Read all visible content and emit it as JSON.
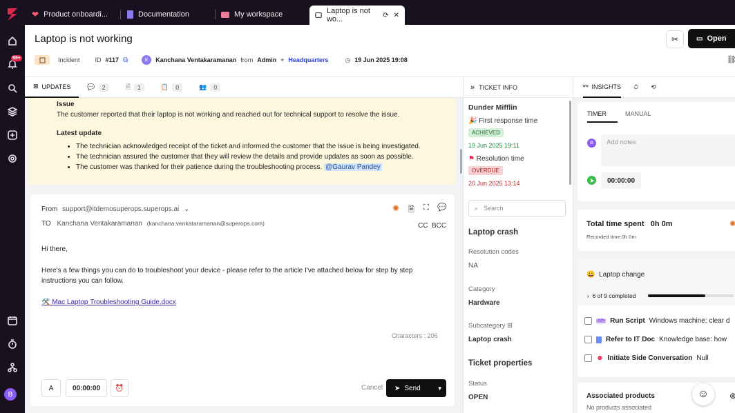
{
  "tabs": [
    {
      "label": "Product onboardi..."
    },
    {
      "label": "Documentation"
    },
    {
      "label": "My workspace"
    },
    {
      "label": "Laptop is not wo..."
    }
  ],
  "rail": {
    "notif_badge": "99+",
    "avatar": "B"
  },
  "ticket": {
    "title": "Laptop is not working",
    "type": "Incident",
    "id_label": "ID",
    "id": "#117",
    "avatar": "K",
    "requester": "Kanchana Ventakaramanan",
    "from_label": "from",
    "org": "Admin",
    "site": "Headquarters",
    "date": "19 Jun 2025 19:08",
    "status_button": "Open"
  },
  "left_tabs": [
    {
      "label": "UPDATES"
    },
    {
      "count": "2"
    },
    {
      "count": "1"
    },
    {
      "count": "0"
    },
    {
      "count": "0"
    }
  ],
  "note": {
    "issue_heading": "Issue",
    "issue_text": "The customer reported that their laptop is not working and reached out for technical support to resolve the issue.",
    "update_heading": "Latest update",
    "bullets": [
      "The technician acknowledged receipt of the ticket and informed the customer that the issue is being investigated.",
      "The technician assured the customer that they will review the details and provide updates as soon as possible.",
      "The customer was thanked for their patience during the troubleshooting process."
    ],
    "mention": "@Gaurav Pandey"
  },
  "composer": {
    "from_label": "From",
    "from": "support@itdemosuperops.superops.ai",
    "to_label": "TO",
    "to_name": "Kanchana Ventakaramanan",
    "to_email": "(kanchana.venkataramanan@superops.com)",
    "cc": "CC",
    "bcc": "BCC",
    "greeting": "Hi there,",
    "body": "Here's a few things you can do to troubleshoot your device - please refer to the article I've attached below for step by step instructions you can follow.",
    "attachment": "🛠️ Mac Laptop Troubleshooting Guide.docx",
    "chars": "Characters : 206",
    "format_btn": "A",
    "timer": "00:00:00",
    "cancel": "Cancel",
    "send": "Send"
  },
  "ticket_info": {
    "header": "TICKET INFO",
    "client": "Dunder Mifflin",
    "first_response_label": "First response time",
    "first_response_status": "ACHIEVED",
    "first_response_date": "19 Jun 2025 19:11",
    "resolution_label": "Resolution time",
    "resolution_status": "OVERDUE",
    "resolution_date": "20 Jun 2025 13:14",
    "search_placeholder": "Search",
    "section": "Laptop crash",
    "res_codes_label": "Resolution codes",
    "res_codes_value": "NA",
    "category_label": "Category",
    "category_value": "Hardware",
    "subcategory_label": "Subcategory",
    "subcategory_value": "Laptop crash",
    "props_heading": "Ticket properties",
    "status_label": "Status",
    "status_value": "OPEN"
  },
  "insights": {
    "header": "INSIGHTS",
    "timer_tab": "TIMER",
    "manual_tab": "MANUAL",
    "notes_placeholder": "Add notes",
    "avatar": "B",
    "timer_value": "00:00:00",
    "total_label": "Total time spent",
    "total_value": "0h 0m",
    "recorded": "Recorded time:0h 0m",
    "checklist_emoji": "😀",
    "checklist_title": "Laptop change",
    "progress_text": "6 of 9 completed",
    "progress": 0.67,
    "items": [
      {
        "title": "Run Script",
        "detail": "Windows machine: clear d"
      },
      {
        "title": "Refer to IT Doc",
        "detail": "Knowledge base: how"
      },
      {
        "title": "Initiate Side Conversation",
        "detail": "Null"
      }
    ],
    "assoc_title": "Associated products",
    "assoc_empty": "No products associated"
  },
  "colors": {
    "accent": "#e0254a",
    "dark": "#1a1120",
    "achieved": "#1e8a3a",
    "overdue": "#c0262c",
    "link": "#2a3fd6"
  }
}
